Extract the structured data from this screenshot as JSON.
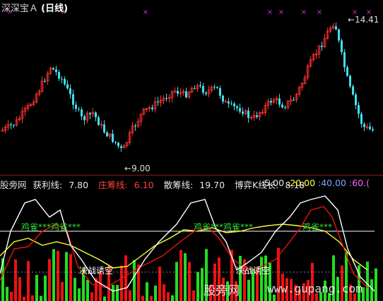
{
  "window": {
    "title": "深深宝Ａ",
    "mode_badge": "(日线)"
  },
  "price_chart": {
    "high_label": "14.41",
    "low_label": "9.00"
  },
  "indicator": {
    "name": "股旁网",
    "items": [
      {
        "label": "获利线:",
        "value": "7.80",
        "color": "#e8e8e8"
      },
      {
        "label": "庄筹线:",
        "value": "6.10",
        "color": "#ff4040"
      },
      {
        "label": "散筹线:",
        "value": "19.70",
        "color": "#e8e8e8"
      },
      {
        "label": "博弈K线长:",
        "value": "8.18",
        "color": "#e8e8e8"
      }
    ],
    "levels": [
      {
        "text": ":5.00",
        "color": "#e8e8e8"
      },
      {
        "text": ":20.00",
        "color": "#ffff40"
      },
      {
        "text": ":40.00",
        "color": "#7aa7ff"
      },
      {
        "text": ":60.(",
        "color": "#ff60ff"
      }
    ],
    "signals": {
      "jique": "鸡雀***鸡雀***",
      "jique2": "鸡雀***鸡雀***",
      "jique3": "鸡雀***",
      "juezhan": "决战诱空",
      "juezhan2": "决战诱空"
    }
  },
  "watermark": {
    "cn": "股旁网",
    "url": "www.gupang.com"
  },
  "colors": {
    "up": "#ff3333",
    "down": "#40e0f0",
    "green": "#22dd22",
    "red": "#ee1111"
  }
}
